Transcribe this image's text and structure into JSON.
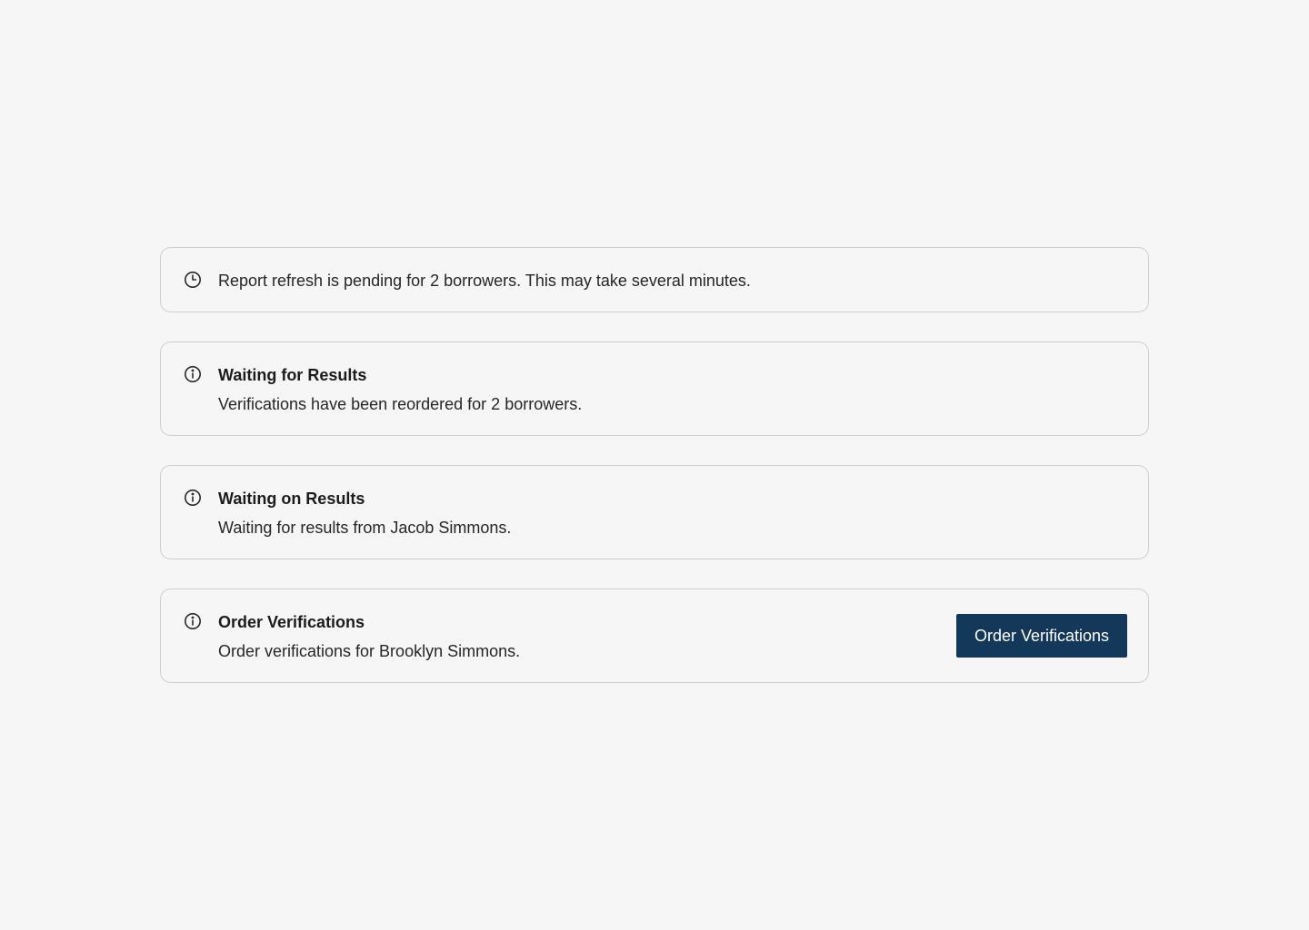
{
  "alerts": [
    {
      "icon": "clock-icon",
      "message": "Report refresh is pending for 2 borrowers. This may take several minutes."
    },
    {
      "icon": "info-icon",
      "title": "Waiting for Results",
      "description": "Verifications have been reordered for 2 borrowers."
    },
    {
      "icon": "info-icon",
      "title": "Waiting on Results",
      "description": "Waiting for results from Jacob Simmons."
    },
    {
      "icon": "info-icon",
      "title": "Order Verifications",
      "description": "Order verifications for Brooklyn Simmons.",
      "button_label": "Order Verifications"
    }
  ],
  "colors": {
    "background": "#f6f6f6",
    "border": "#cfcfcf",
    "button_bg": "#13385a",
    "button_text": "#ffffff",
    "text": "#262626"
  }
}
